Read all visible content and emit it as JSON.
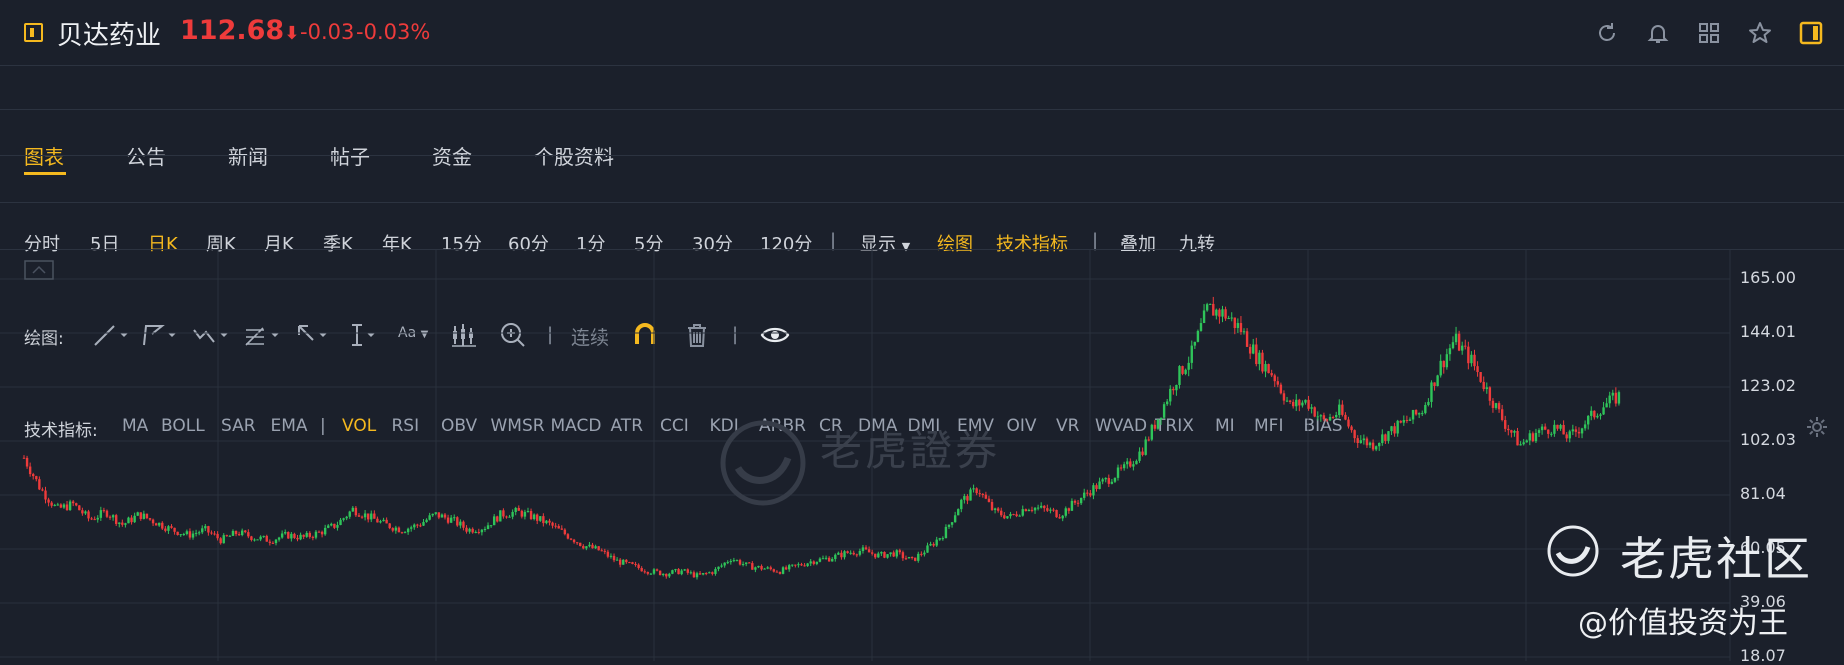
{
  "header": {
    "stock_name": "贝达药业",
    "price": "112.68",
    "price_arrow": "⬇",
    "change_abs": "-0.03",
    "change_pct": "-0.03%",
    "icons": [
      "refresh-icon",
      "bell-icon",
      "grid-icon",
      "star-icon",
      "panel-toggle-icon"
    ]
  },
  "nav": {
    "tabs": [
      {
        "label": "图表",
        "active": true
      },
      {
        "label": "公告",
        "active": false
      },
      {
        "label": "新闻",
        "active": false
      },
      {
        "label": "帖子",
        "active": false
      },
      {
        "label": "资金",
        "active": false
      },
      {
        "label": "个股资料",
        "active": false
      }
    ]
  },
  "periods": {
    "items": [
      "分时",
      "5日",
      "日K",
      "周K",
      "月K",
      "季K",
      "年K",
      "15分",
      "60分",
      "1分",
      "5分",
      "30分",
      "120分"
    ],
    "active": "日K",
    "separator": "|",
    "display_label": "显示",
    "draw_label": "绘图",
    "tech_label": "技术指标",
    "overlay_label": "叠加",
    "nine_turn_label": "九转"
  },
  "drawbar": {
    "label": "绘图:",
    "font_tool_label": "Aa",
    "continuous_label": "连续",
    "separator": "|"
  },
  "indicators": {
    "label": "技术指标:",
    "items": [
      "MA",
      "BOLL",
      "SAR",
      "EMA",
      "|",
      "VOL",
      "RSI",
      "OBV",
      "WMSR",
      "MACD",
      "ATR",
      "CCI",
      "KDJ",
      "ARBR",
      "CR",
      "DMA",
      "DMI",
      "EMV",
      "OIV",
      "VR",
      "WVAD",
      "TRIX",
      "MI",
      "MFI",
      "BIAS"
    ],
    "active": "VOL"
  },
  "chart_data": {
    "type": "candlestick",
    "y_ticks": [
      "165.00",
      "144.01",
      "123.02",
      "102.03",
      "81.04",
      "60.05",
      "39.06",
      "18.07"
    ],
    "ylim": [
      18.07,
      165.0
    ],
    "grid": true,
    "up_color": "#2fc45a",
    "down_color": "#ee3b3b",
    "series_close": [
      92,
      80,
      72,
      74,
      68,
      71,
      66,
      70,
      67,
      64,
      62,
      64,
      60,
      63,
      61,
      60,
      62,
      61,
      63,
      66,
      72,
      69,
      66,
      64,
      66,
      70,
      68,
      64,
      65,
      70,
      71,
      69,
      66,
      62,
      58,
      56,
      52,
      50,
      48,
      47,
      48,
      46,
      48,
      53,
      50,
      49,
      48,
      50,
      52,
      53,
      55,
      56,
      54,
      55,
      52,
      57,
      63,
      75,
      80,
      71,
      69,
      73,
      72,
      70,
      75,
      80,
      84,
      88,
      95,
      108,
      122,
      132,
      150,
      148,
      142,
      131,
      124,
      112,
      114,
      106,
      110,
      100,
      97,
      102,
      106,
      110,
      126,
      138,
      130,
      118,
      106,
      97,
      102,
      104,
      100,
      106,
      112,
      116
    ]
  },
  "watermarks": {
    "center": "老虎證券",
    "corner_brand": "老虎社区",
    "author": "@价值投资为王"
  },
  "colors": {
    "background": "#1b202b",
    "accent": "#f5b91f",
    "down": "#ee3b3b",
    "up": "#2fc45a"
  }
}
